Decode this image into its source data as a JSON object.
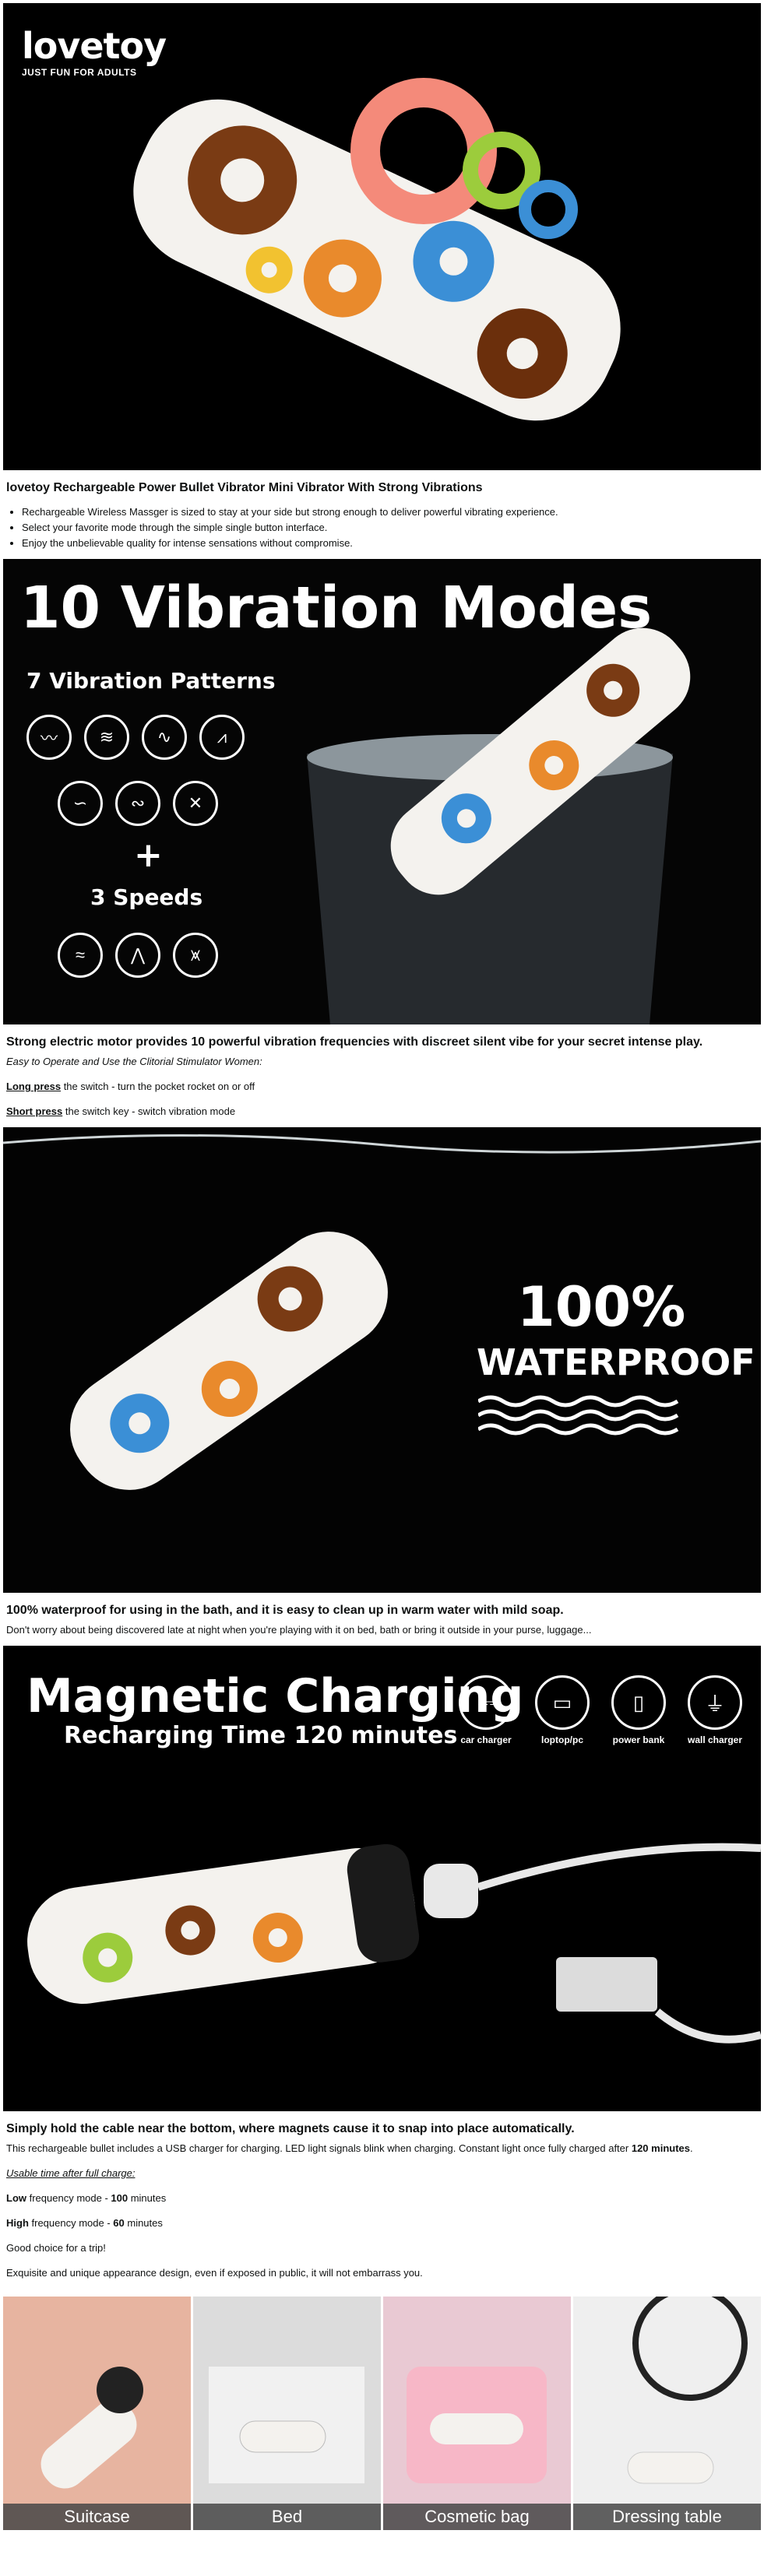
{
  "brand": {
    "name": "lovetoy",
    "tagline": "JUST FUN FOR ADULTS"
  },
  "section1": {
    "heading": "lovetoy Rechargeable Power Bullet Vibrator Mini Vibrator With Strong Vibrations",
    "bullets": [
      "Rechargeable Wireless Massger is sized to stay at your side but strong enough to deliver powerful vibrating experience.",
      "Select your favorite mode through the simple single button interface.",
      "Enjoy the unbelievable quality for intense sensations without compromise."
    ]
  },
  "banner2": {
    "title": "10 Vibration Modes",
    "patterns": "7 Vibration Patterns",
    "plus": "+",
    "speeds": "3 Speeds"
  },
  "section2": {
    "heading": "Strong electric motor provides 10 powerful vibration frequencies with discreet silent vibe for your secret intense play.",
    "sub": "Easy to Operate and Use the Clitorial Stimulator Women:",
    "long_press_label": "Long press",
    "long_press_text": " the switch - turn the pocket rocket on or off",
    "short_press_label": "Short press",
    "short_press_text": " the switch key - switch vibration mode"
  },
  "banner3": {
    "percent": "100%",
    "word": "WATERPROOF"
  },
  "section3": {
    "heading": "100% waterproof for using in the bath, and it is easy to clean up in warm water with mild soap.",
    "text": "Don't worry about being discovered late at night when you're playing with it on bed, bath or bring it outside in your purse, luggage..."
  },
  "banner4": {
    "title": "Magnetic Charging",
    "subtitle": "Recharging Time 120 minutes",
    "chargers": [
      "car charger",
      "loptop/pc",
      "power bank",
      "wall charger"
    ]
  },
  "section4": {
    "heading": "Simply hold the cable near the bottom, where magnets cause it to snap into place automatically.",
    "charging_text": "This rechargeable bullet includes a USB charger for charging. LED light signals blink when charging. Constant light once fully charged after ",
    "charging_time": "120 minutes",
    "charging_end": ".",
    "usable": "Usable time after full charge:",
    "low_label": "Low",
    "low_text": " frequency mode - ",
    "low_val": "100",
    "low_unit": " minutes",
    "high_label": "High",
    "high_text": " frequency mode - ",
    "high_val": "60",
    "high_unit": " minutes",
    "gift": "Good choice for a trip!",
    "design": "Exquisite and unique appearance design, even if exposed in public, it will not embarrass you."
  },
  "locations": [
    "Suitcase",
    "Bed",
    "Cosmetic bag",
    "Dressing table"
  ],
  "colors": {
    "banner_bg": "#000000",
    "donut_white": "#f4f2ee"
  }
}
